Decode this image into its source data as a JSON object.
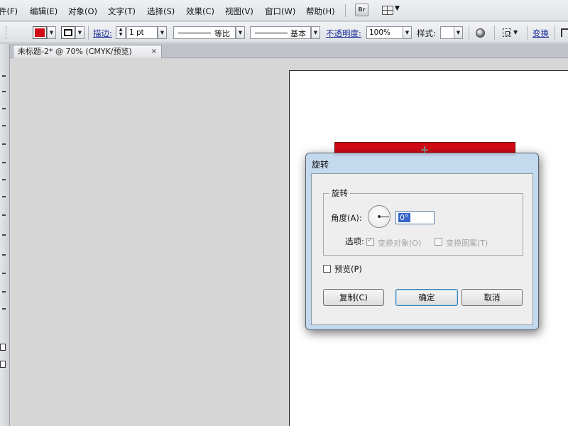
{
  "menu": {
    "items": [
      "件(F)",
      "编辑(E)",
      "对象(O)",
      "文字(T)",
      "选择(S)",
      "效果(C)",
      "视图(V)",
      "窗口(W)",
      "帮助(H)"
    ],
    "bridge_label": "Br"
  },
  "control_bar": {
    "fill_color": "#d10a16",
    "stroke_label": "描边:",
    "stroke_weight": "1 pt",
    "profile_label": "等比",
    "brush_label": "基本",
    "opacity_label": "不透明度:",
    "opacity_value": "100%",
    "style_label": "样式:",
    "transform_label": "变换"
  },
  "document_tab": {
    "title": "未标题-2* @ 70% (CMYK/预览)",
    "close_glyph": "×"
  },
  "artwork": {
    "rect_color": "#d10a16"
  },
  "dialog": {
    "title": "旋转",
    "group_title": "旋转",
    "angle_label": "角度(A):",
    "angle_value": "0°",
    "options_label": "选项:",
    "transform_objects_label": "变换对象(O)",
    "transform_objects_checked": true,
    "transform_patterns_label": "变换图案(T)",
    "transform_patterns_checked": false,
    "preview_label": "预览(P)",
    "preview_checked": false,
    "copy_button": "复制(C)",
    "ok_button": "确定",
    "cancel_button": "取消"
  }
}
